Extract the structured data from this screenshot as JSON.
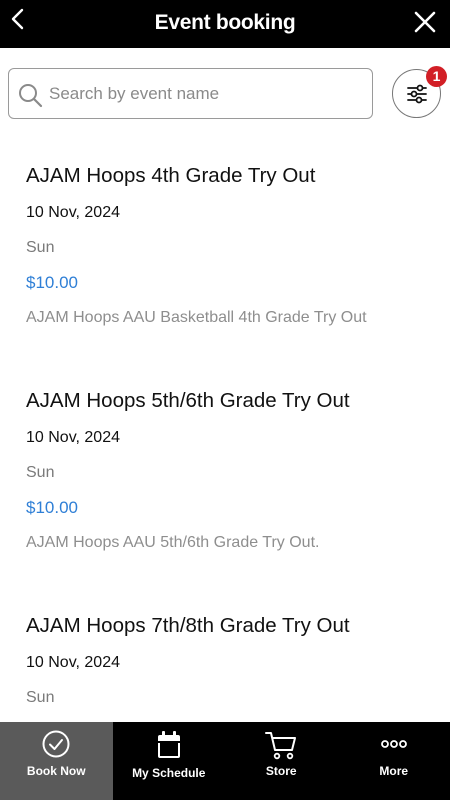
{
  "header": {
    "title": "Event booking",
    "back_icon": "chevron-left-icon",
    "close_icon": "close-icon"
  },
  "search": {
    "placeholder": "Search by event name",
    "value": ""
  },
  "filter": {
    "icon": "sliders-icon",
    "badge_count": "1",
    "badge_color": "#d21f26"
  },
  "events": [
    {
      "name": "AJAM Hoops 4th Grade Try Out",
      "date": "10 Nov, 2024",
      "day": "Sun",
      "price": "$10.00",
      "description": "AJAM Hoops AAU Basketball 4th Grade Try Out"
    },
    {
      "name": "AJAM Hoops 5th/6th Grade Try Out",
      "date": "10 Nov, 2024",
      "day": "Sun",
      "price": "$10.00",
      "description": "AJAM Hoops AAU 5th/6th Grade Try Out."
    },
    {
      "name": "AJAM Hoops 7th/8th Grade Try Out",
      "date": "10 Nov, 2024",
      "day": "Sun",
      "price": "",
      "description": ""
    }
  ],
  "tabbar": {
    "items": [
      {
        "label": "Book Now",
        "icon": "check-circle-icon",
        "active": true
      },
      {
        "label": "My Schedule",
        "icon": "calendar-icon",
        "active": false
      },
      {
        "label": "Store",
        "icon": "cart-icon",
        "active": false
      },
      {
        "label": "More",
        "icon": "more-dots-icon",
        "active": false
      }
    ]
  },
  "colors": {
    "header_bg": "#000000",
    "price": "#2f7fd6",
    "active_tab_bg": "#5a5a5a"
  }
}
